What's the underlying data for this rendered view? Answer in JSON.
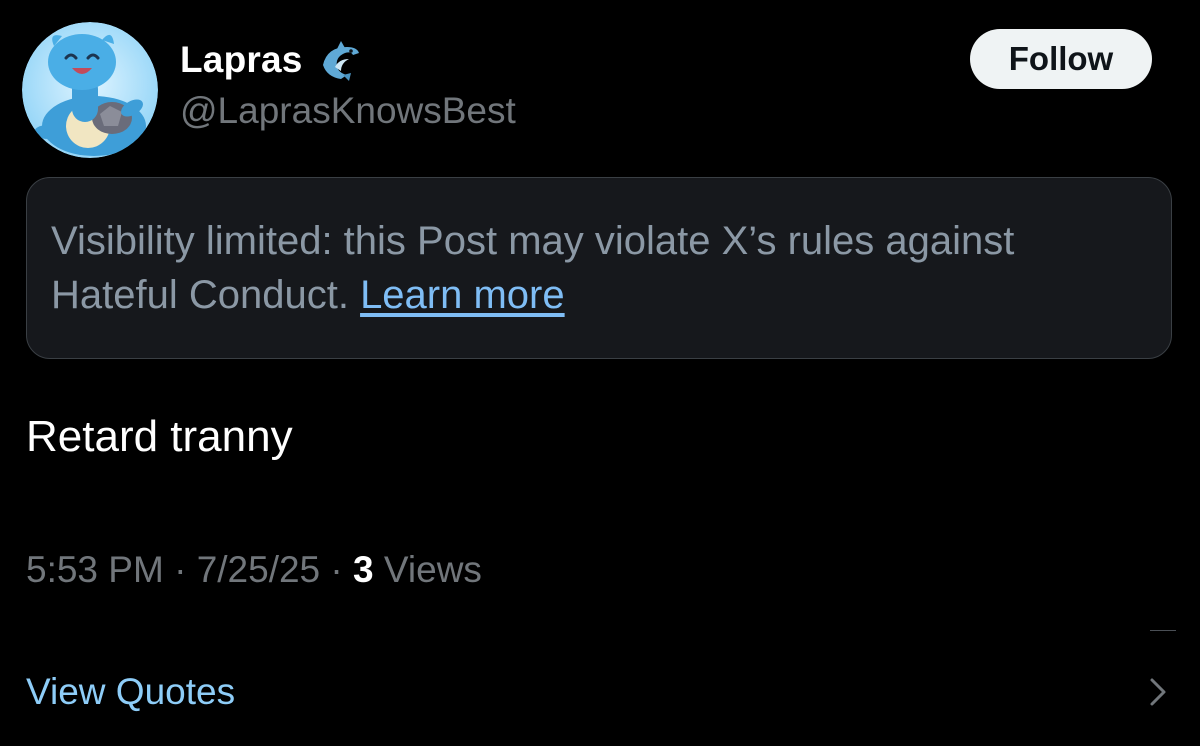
{
  "post": {
    "author": {
      "display_name": "Lapras",
      "badge_icon": "dolphin-emoji-icon",
      "handle": "@LaprasKnowsBest"
    },
    "follow_label": "Follow",
    "notice": {
      "text": "Visibility limited: this Post may violate X’s rules against Hateful Conduct.",
      "link_label": "Learn more"
    },
    "text": "Retard tranny",
    "meta": {
      "time": "5:53 PM",
      "date": "7/25/25",
      "separator": "·",
      "views_count": "3",
      "views_label": "Views"
    },
    "view_quotes_label": "View Quotes"
  },
  "colors": {
    "background": "#000000",
    "accent_link": "#8ecdf8",
    "secondary_text": "#71767b",
    "follow_button": "#eff3f4"
  }
}
